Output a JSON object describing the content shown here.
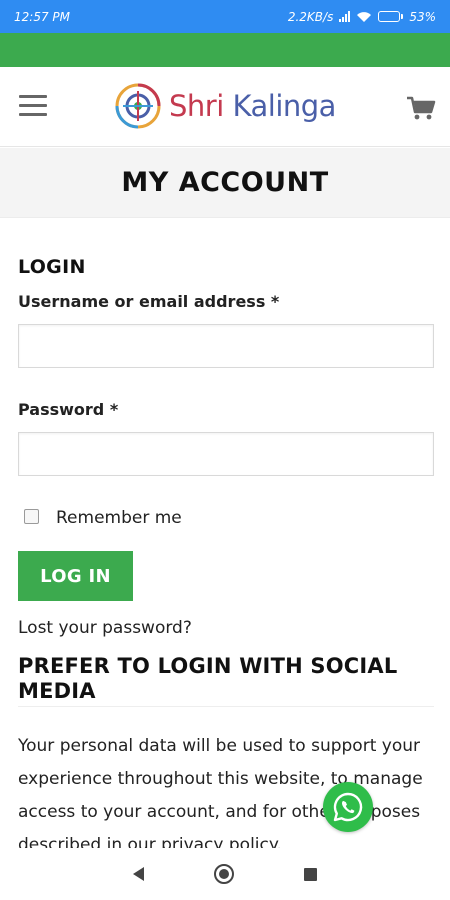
{
  "status_bar": {
    "time": "12:57 PM",
    "net_speed": "2.2KB/s",
    "battery": "53%",
    "battery_level": 0.53
  },
  "header": {
    "logo_text_1": "Shri",
    "logo_text_2": "Kalinga",
    "menu_icon": "hamburger-icon",
    "cart_icon": "cart-icon"
  },
  "page": {
    "title": "MY ACCOUNT"
  },
  "login": {
    "heading": "LOGIN",
    "username_label": "Username or email address *",
    "username_value": "",
    "password_label": "Password *",
    "password_value": "",
    "remember_label": "Remember me",
    "remember_checked": false,
    "button_label": "LOG IN",
    "lost_password": "Lost your password?"
  },
  "social": {
    "heading": "PREFER TO LOGIN WITH SOCIAL MEDIA"
  },
  "privacy": {
    "text": "Your personal data will be used to support your experience throughout this website, to manage access to your account, and for other purposes described in our privacy policy."
  },
  "colors": {
    "status_bar": "#2f8cf2",
    "accent_green": "#3caa4e",
    "whatsapp_green": "#2fbd4a",
    "logo_blue": "#4a5fa8",
    "logo_red": "#c43a4f"
  }
}
